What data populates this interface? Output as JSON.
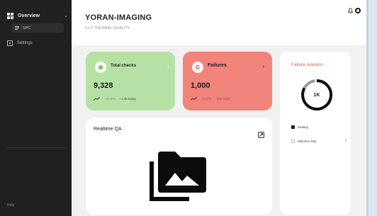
{
  "sidebar": {
    "overview_label": "Overview",
    "sub_item_label": "SPC",
    "settings_label": "Settings",
    "help_label": "Help"
  },
  "header": {
    "title": "YORAN-IMAGING",
    "subtitle": "ILLY THERMAL QUALITY"
  },
  "total_checks": {
    "title": "Total checks",
    "value": "9,328",
    "change": "+15.6%",
    "today": "+1.4k today"
  },
  "failures": {
    "title": "Failures",
    "value": "1,000",
    "change": "-12.7%",
    "today": "-300 today"
  },
  "failure_reasons": {
    "title": "Failure reasons",
    "center_label": "1K",
    "legend": [
      {
        "label": "Sealing",
        "color": "#222222"
      },
      {
        "label": "Machine stop",
        "color": "#ffffff"
      }
    ]
  },
  "realtime": {
    "title": "Realtime QA"
  },
  "colors": {
    "total_card": "#b5e2a4",
    "failure_card": "#f2847c",
    "reasons_title": "#e5564a",
    "sidebar": "#202020"
  },
  "icons": [
    "overview-grid-icon",
    "chevron-down-icon",
    "menu-lines-icon",
    "settings-icon",
    "bell-icon",
    "user-dot-icon",
    "check-icon",
    "refresh-icon",
    "arrow-right-icon",
    "trend-icon",
    "expand-icon",
    "photo-library-icon"
  ]
}
